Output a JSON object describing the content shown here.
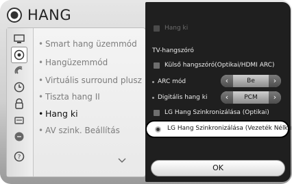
{
  "header": {
    "title": "HANG"
  },
  "menu": {
    "items": [
      {
        "label": "Smart hang üzemmód"
      },
      {
        "label": "Hangüzemmód"
      },
      {
        "label": "Virtuális surround plusz"
      },
      {
        "label": "Tiszta hang II"
      },
      {
        "label": "Hang ki"
      },
      {
        "label": "AV szink. Beállítás"
      }
    ],
    "active_index": 4
  },
  "categories": [
    {
      "icon": "picture-icon"
    },
    {
      "icon": "sound-icon"
    },
    {
      "icon": "network-icon"
    },
    {
      "icon": "time-icon"
    },
    {
      "icon": "lock-icon"
    },
    {
      "icon": "option-icon"
    },
    {
      "icon": "support-icon"
    },
    {
      "icon": "help-icon"
    }
  ],
  "panel": {
    "hang_ki_label": "Hang ki",
    "tv_speaker_label": "TV-hangszóró",
    "external_speaker_label": "Külső hangszóró(Optikai/HDMI ARC)",
    "arc_label": "ARC mód",
    "arc_value": "Be",
    "digital_label": "Digitális hang ki",
    "digital_value": "PCM",
    "lg_optical_label": "LG Hang Szinkronizálása (Optikai)",
    "lg_wireless_label": "LG Hang Szinkronizálása (Vezeték Nélkül)",
    "ok_label": "OK"
  },
  "colors": {
    "panel_bg": "#1f1f1f",
    "frame_bg": "#d9d9d9",
    "highlight_bg": "#ffffff"
  }
}
